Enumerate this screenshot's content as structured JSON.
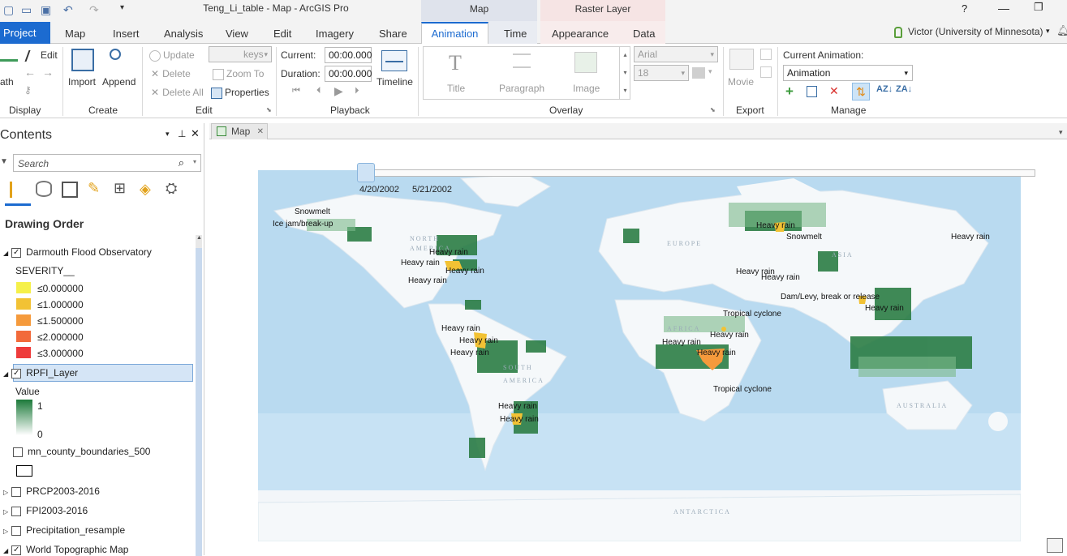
{
  "window": {
    "title": "Teng_Li_table - Map - ArcGIS Pro",
    "context_map": "Map",
    "context_raster": "Raster Layer",
    "help": "?"
  },
  "tabs": [
    "Project",
    "Map",
    "Insert",
    "Analysis",
    "View",
    "Edit",
    "Imagery",
    "Share",
    "Animation",
    "Time",
    "Appearance",
    "Data"
  ],
  "user": "Victor (University of Minnesota)",
  "ribbon": {
    "display": {
      "edit": "Edit",
      "path": "ath",
      "label": "Display"
    },
    "create": {
      "import": "Import",
      "append": "Append",
      "label": "Create"
    },
    "edit": {
      "update": "Update",
      "delete": "Delete",
      "delete_all": "Delete All",
      "keys": "keys",
      "zoom_to": "Zoom To",
      "properties": "Properties",
      "label": "Edit"
    },
    "playback": {
      "current_label": "Current:",
      "current_value": "00:00.000",
      "duration_label": "Duration:",
      "duration_value": "00:00.000",
      "timeline": "Timeline",
      "label": "Playback"
    },
    "overlay": {
      "title": "Title",
      "paragraph": "Paragraph",
      "image": "Image",
      "label": "Overlay"
    },
    "text": {
      "font": "Arial",
      "size": "18"
    },
    "export": {
      "movie": "Movie",
      "label": "Export"
    },
    "manage": {
      "current_label": "Current Animation:",
      "current_value": "Animation",
      "label": "Manage"
    }
  },
  "contents": {
    "title": "Contents",
    "search_placeholder": "Search",
    "drawing_order": "Drawing Order",
    "dfo_layer": "Darmouth Flood Observatory",
    "severity_field": "SEVERITY__",
    "severity_classes": [
      {
        "label": "≤0.000000",
        "color": "#f5f04a"
      },
      {
        "label": "≤1.000000",
        "color": "#f2c234"
      },
      {
        "label": "≤1.500000",
        "color": "#f59a3c"
      },
      {
        "label": "≤2.000000",
        "color": "#f26a3a"
      },
      {
        "label": "≤3.000000",
        "color": "#ee3b3b"
      }
    ],
    "rpfi_layer": "RPFI_Layer",
    "value_label": "Value",
    "value_max": "1",
    "value_min": "0",
    "layers_bottom": [
      "mn_county_boundaries_500",
      "PRCP2003-2016",
      "FPI2003-2016",
      "Precipitation_resample",
      "World Topographic Map"
    ]
  },
  "map": {
    "tab": "Map",
    "time_start": "4/20/2002",
    "time_end": "5/21/2002",
    "event_labels": [
      "Snowmelt",
      "Ice jam/break-up",
      "Heavy rain",
      "Heavy rain",
      "Heavy rain",
      "Heavy rain",
      "Heavy rain",
      "Heavy rain",
      "Snowmelt",
      "Heavy rain",
      "Heavy rain",
      "Heavy rain",
      "Dam/Levy, break or release",
      "Heavy rain",
      "Tropical cyclone",
      "Heavy rain",
      "Heavy rain",
      "Heavy rain",
      "Heavy rain",
      "Heavy rain",
      "Heavy rain",
      "Heavy rain",
      "Tropical cyclone",
      "Heavy rain",
      "Heavy rain"
    ],
    "geo_labels": [
      "NORTH",
      "AMERICA",
      "EUROPE",
      "ASIA",
      "AFRICA",
      "SOUTH",
      "AMERICA",
      "AUSTRALIA",
      "ANTARCTICA"
    ]
  }
}
